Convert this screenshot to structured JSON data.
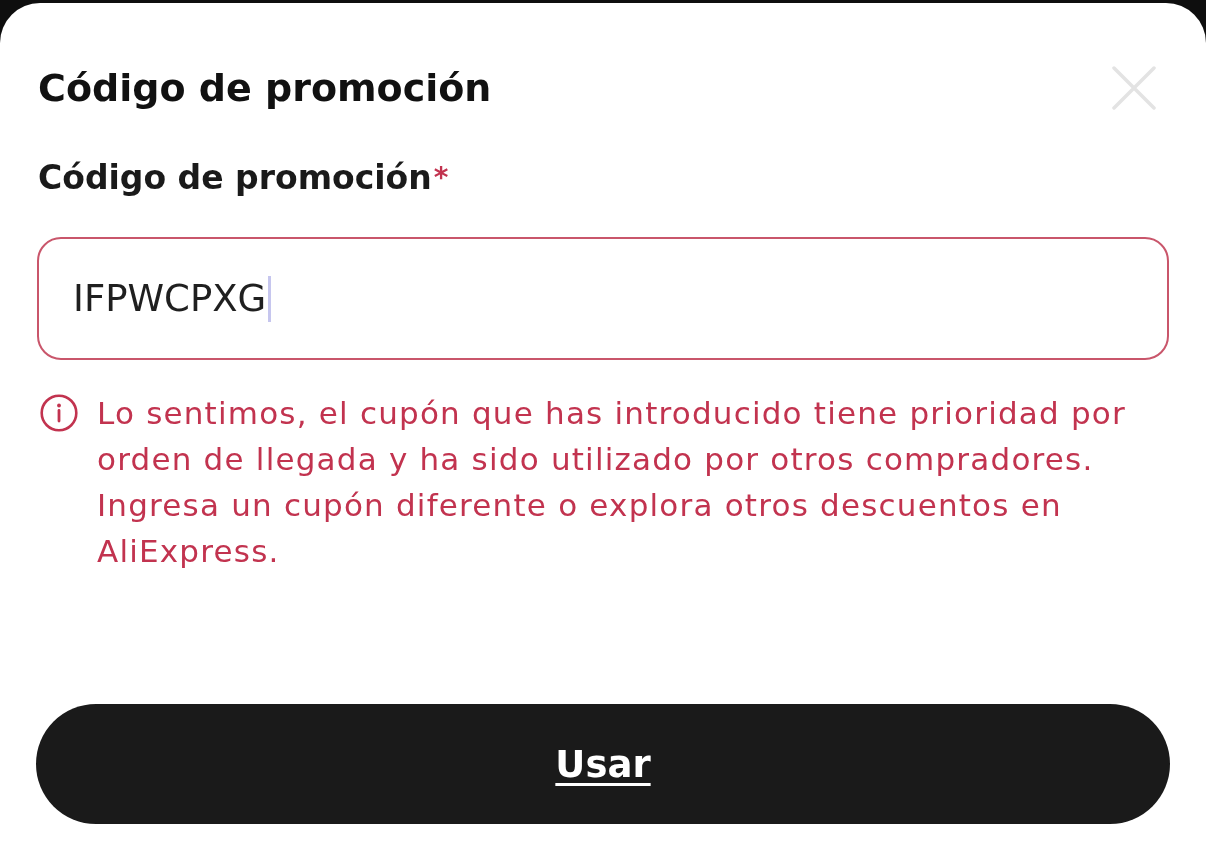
{
  "sheet": {
    "title": "Código de promoción"
  },
  "form": {
    "label": "Código de promoción",
    "required_mark": "*",
    "value": "IFPWCPXG",
    "focused": true,
    "invalid": true,
    "error_message": "Lo sentimos, el cupón que has introducido tiene prioridad por orden de llegada y ha sido utilizado por otros compradores. Ingresa un cupón diferente o explora otros descuentos en AliExpress."
  },
  "button": {
    "label": "Usar"
  }
}
